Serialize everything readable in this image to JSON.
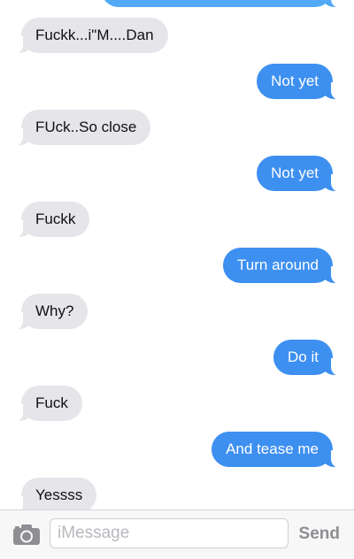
{
  "messages": [
    {
      "dir": "out",
      "text": ""
    },
    {
      "dir": "in",
      "text": "Fuckk...i\"M....Dan"
    },
    {
      "dir": "out",
      "text": "Not yet"
    },
    {
      "dir": "in",
      "text": "FUck..So close"
    },
    {
      "dir": "out",
      "text": "Not yet"
    },
    {
      "dir": "in",
      "text": "Fuckk"
    },
    {
      "dir": "out",
      "text": "Turn around"
    },
    {
      "dir": "in",
      "text": "Why?"
    },
    {
      "dir": "out",
      "text": "Do it"
    },
    {
      "dir": "in",
      "text": "Fuck"
    },
    {
      "dir": "out",
      "text": "And tease me"
    },
    {
      "dir": "in",
      "text": "Yessss"
    }
  ],
  "input_bar": {
    "placeholder": "iMessage",
    "send_label": "Send",
    "camera_icon": "camera-icon"
  },
  "colors": {
    "outgoing": "#3d8ff0",
    "incoming": "#e5e5ea",
    "send_disabled": "#8e8e93"
  }
}
